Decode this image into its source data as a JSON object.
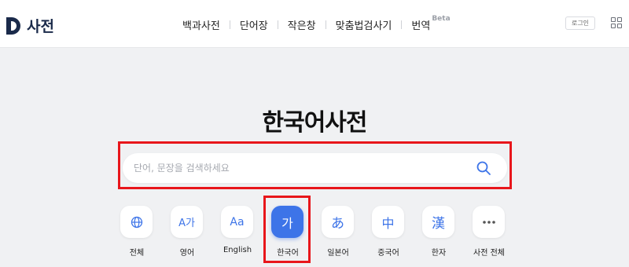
{
  "header": {
    "logo_text": "사전",
    "nav": [
      {
        "label": "백과사전"
      },
      {
        "label": "단어장"
      },
      {
        "label": "작은창"
      },
      {
        "label": "맞춤법검사기"
      },
      {
        "label": "번역",
        "badge": "Beta"
      }
    ],
    "login_label": "로그인",
    "menu_icon": "grid-icon"
  },
  "main": {
    "title": "한국어사전",
    "search": {
      "placeholder": "단어, 문장을 검색하세요",
      "value": "",
      "icon": "search-icon"
    },
    "categories": [
      {
        "label": "전체",
        "icon": "globe-icon",
        "glyph": ""
      },
      {
        "label": "영어",
        "icon": "english-icon",
        "glyph": "A가"
      },
      {
        "label": "English",
        "icon": "english-english-icon",
        "glyph": "Aa"
      },
      {
        "label": "한국어",
        "icon": "korean-icon",
        "glyph": "가",
        "selected": true
      },
      {
        "label": "일본어",
        "icon": "japanese-icon",
        "glyph": "あ"
      },
      {
        "label": "중국어",
        "icon": "chinese-icon",
        "glyph": "中"
      },
      {
        "label": "한자",
        "icon": "hanja-icon",
        "glyph": "漢"
      },
      {
        "label": "사전 전체",
        "icon": "more-icon",
        "glyph": ""
      }
    ]
  },
  "colors": {
    "accent": "#3d74e8",
    "highlight": "#e8161b",
    "background": "#f0f1f3",
    "brand": "#1a2a4a"
  }
}
